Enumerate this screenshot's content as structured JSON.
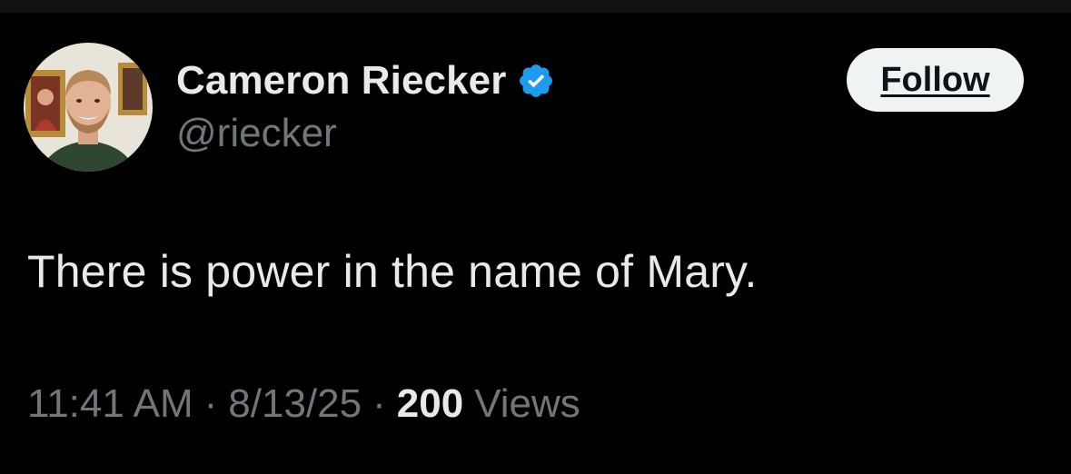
{
  "tweet": {
    "author": {
      "display_name": "Cameron Riecker",
      "handle": "@riecker",
      "verified": true,
      "verified_icon": "verified-badge-icon",
      "avatar": "profile-photo"
    },
    "follow_label": "Follow",
    "text": "There is power in the name of Mary.",
    "meta": {
      "time": "11:41 AM",
      "separator": "·",
      "date": "8/13/25",
      "views_count": "200",
      "views_label": "Views"
    }
  },
  "colors": {
    "background": "#000000",
    "primary_text": "#e7e9ea",
    "secondary_text": "#71767b",
    "verified_blue": "#1d9bf0",
    "follow_bg": "#eff3f4",
    "follow_text": "#0f1419"
  }
}
